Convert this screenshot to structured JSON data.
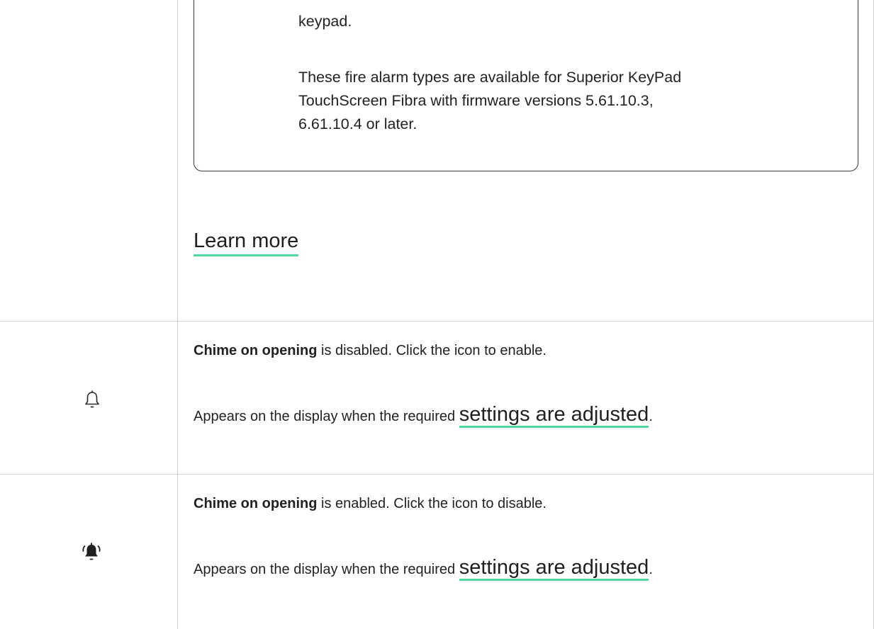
{
  "note": {
    "line_top": "keypad.",
    "paragraph_lines": [
      "These fire alarm types are available for Superior KeyPad",
      "TouchScreen Fibra with firmware versions 5.61.10.3,",
      "6.61.10.4 or later."
    ]
  },
  "learn_more": {
    "label": "Learn more"
  },
  "rows": [
    {
      "icon": "bell-outline-icon",
      "bold": "Chime on opening",
      "rest": " is disabled. Click the icon to enable.",
      "appears_prefix": "Appears on the display when the required ",
      "link": "settings are adjusted",
      "suffix": "."
    },
    {
      "icon": "bell-ringing-filled-icon",
      "bold": "Chime on opening",
      "rest": " is enabled. Click the icon to disable.",
      "appears_prefix": "Appears on the display when the required ",
      "link": "settings are adjusted",
      "suffix": "."
    }
  ],
  "colors": {
    "link_underline": "#4fd9a1",
    "border": "#d8d8d8",
    "text": "#1f1f1f"
  }
}
